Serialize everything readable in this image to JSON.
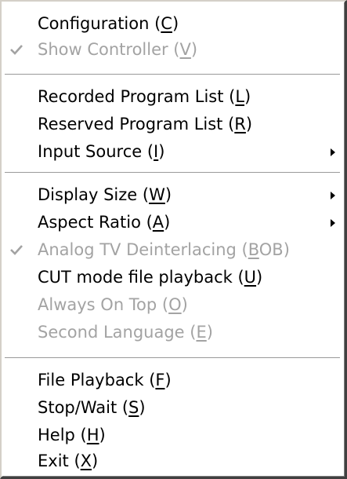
{
  "menu": {
    "items": [
      {
        "pre": "Configuration (",
        "key": "C",
        "post": ")",
        "disabled": false,
        "checked": false,
        "submenu": false
      },
      {
        "pre": "Show Controller (",
        "key": "V",
        "post": ")",
        "disabled": true,
        "checked": true,
        "submenu": false
      },
      {
        "pre": "Recorded Program List (",
        "key": "L",
        "post": ")",
        "disabled": false,
        "checked": false,
        "submenu": false
      },
      {
        "pre": "Reserved Program List (",
        "key": "R",
        "post": ")",
        "disabled": false,
        "checked": false,
        "submenu": false
      },
      {
        "pre": "Input Source (",
        "key": "I",
        "post": ")",
        "disabled": false,
        "checked": false,
        "submenu": true
      },
      {
        "pre": "Display Size (",
        "key": "W",
        "post": ")",
        "disabled": false,
        "checked": false,
        "submenu": true
      },
      {
        "pre": "Aspect Ratio (",
        "key": "A",
        "post": ")",
        "disabled": false,
        "checked": false,
        "submenu": true
      },
      {
        "pre": "Analog TV Deinterlacing (",
        "key": "B",
        "post": "OB)",
        "disabled": true,
        "checked": true,
        "submenu": false
      },
      {
        "pre": "CUT mode file playback (",
        "key": "U",
        "post": ")",
        "disabled": false,
        "checked": false,
        "submenu": false
      },
      {
        "pre": "Always On Top (",
        "key": "O",
        "post": ")",
        "disabled": true,
        "checked": false,
        "submenu": false
      },
      {
        "pre": "Second Language (",
        "key": "E",
        "post": ")",
        "disabled": true,
        "checked": false,
        "submenu": false
      },
      {
        "pre": "File Playback (",
        "key": "F",
        "post": ")",
        "disabled": false,
        "checked": false,
        "submenu": false
      },
      {
        "pre": "Stop/Wait (",
        "key": "S",
        "post": ")",
        "disabled": false,
        "checked": false,
        "submenu": false
      },
      {
        "pre": "Help (",
        "key": "H",
        "post": ")",
        "disabled": false,
        "checked": false,
        "submenu": false
      },
      {
        "pre": "Exit (",
        "key": "X",
        "post": ")",
        "disabled": false,
        "checked": false,
        "submenu": false
      }
    ],
    "icons": {
      "check": "checkmark-icon",
      "submenu": "submenu-arrow-icon"
    },
    "colors": {
      "text": "#000000",
      "disabled_text": "#a3a3a3",
      "background": "#ffffff"
    }
  }
}
